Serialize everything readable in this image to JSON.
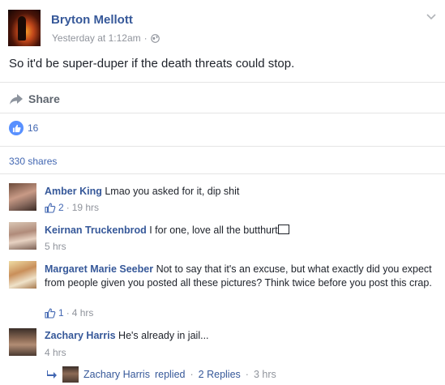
{
  "post": {
    "author": "Bryton Mellott",
    "timestamp": "Yesterday at 1:12am",
    "meta_separator": "·",
    "text": "So it'd be super-duper if the death threats could stop."
  },
  "actions": {
    "share_label": "Share"
  },
  "reactions": {
    "like_count": "16"
  },
  "shares": {
    "label": "330 shares"
  },
  "comments": [
    {
      "name": "Amber King",
      "text": "Lmao you asked for it, dip shit",
      "likes": "2",
      "time": "19 hrs"
    },
    {
      "name": "Keirnan Truckenbrod",
      "text": "I for one, love all the butthurt",
      "time": "5 hrs"
    },
    {
      "name": "Margaret Marie Seeber",
      "text": "Not to say that it's an excuse, but what exactly did you expect from people given you posted all these pictures? Think twice before you post this crap.",
      "likes": "1",
      "time": "4 hrs"
    },
    {
      "name": "Zachary Harris",
      "text": "He's already in jail...",
      "time": "4 hrs"
    }
  ],
  "replies": {
    "author": "Zachary Harris",
    "verb": "replied",
    "count_label": "2 Replies",
    "time": "3 hrs"
  },
  "colors": {
    "link": "#365899",
    "accent": "#4267b2",
    "muted": "#90949c",
    "like_badge": "#5890ff"
  }
}
